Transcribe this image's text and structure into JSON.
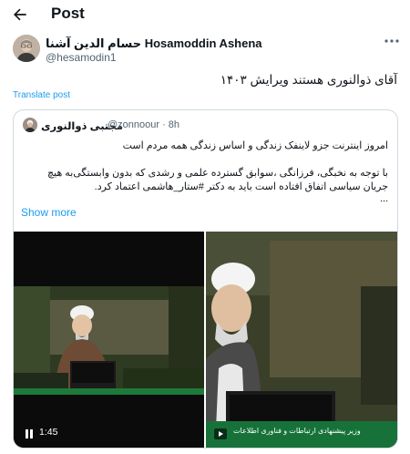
{
  "header": {
    "title": "Post"
  },
  "author": {
    "name": "حسام الدین آشنا Hosamoddin Ashena",
    "handle": "@hesamodin1"
  },
  "post": {
    "text": "آقای ذوالنوری هستند ویرایش ۱۴۰۳",
    "translate_label": "Translate post"
  },
  "quote": {
    "name": "مجتبی ذوالنوری",
    "handle": "@zonnoour · 8h",
    "line1": "امروز اینترنت جزو لاینفک زندگی و اساس زندگی همه مردم است",
    "line2": "با توجه به نخبگی، فرزانگی ،سوابق گسترده علمی و رشدی که بدون وابستگی‌به هیچ جریان سیاسی اتفاق افتاده است باید به دکتر #ستار_هاشمی اعتماد کرد.",
    "ellipsis": "...",
    "show_more": "Show more"
  },
  "media": {
    "left_duration": "1:45",
    "right_banner": "وزیر پیشنهادی ارتباطات و فناوری اطلاعات"
  },
  "colors": {
    "link": "#1d9bf0",
    "muted": "#536471",
    "border": "#cfd9de"
  }
}
